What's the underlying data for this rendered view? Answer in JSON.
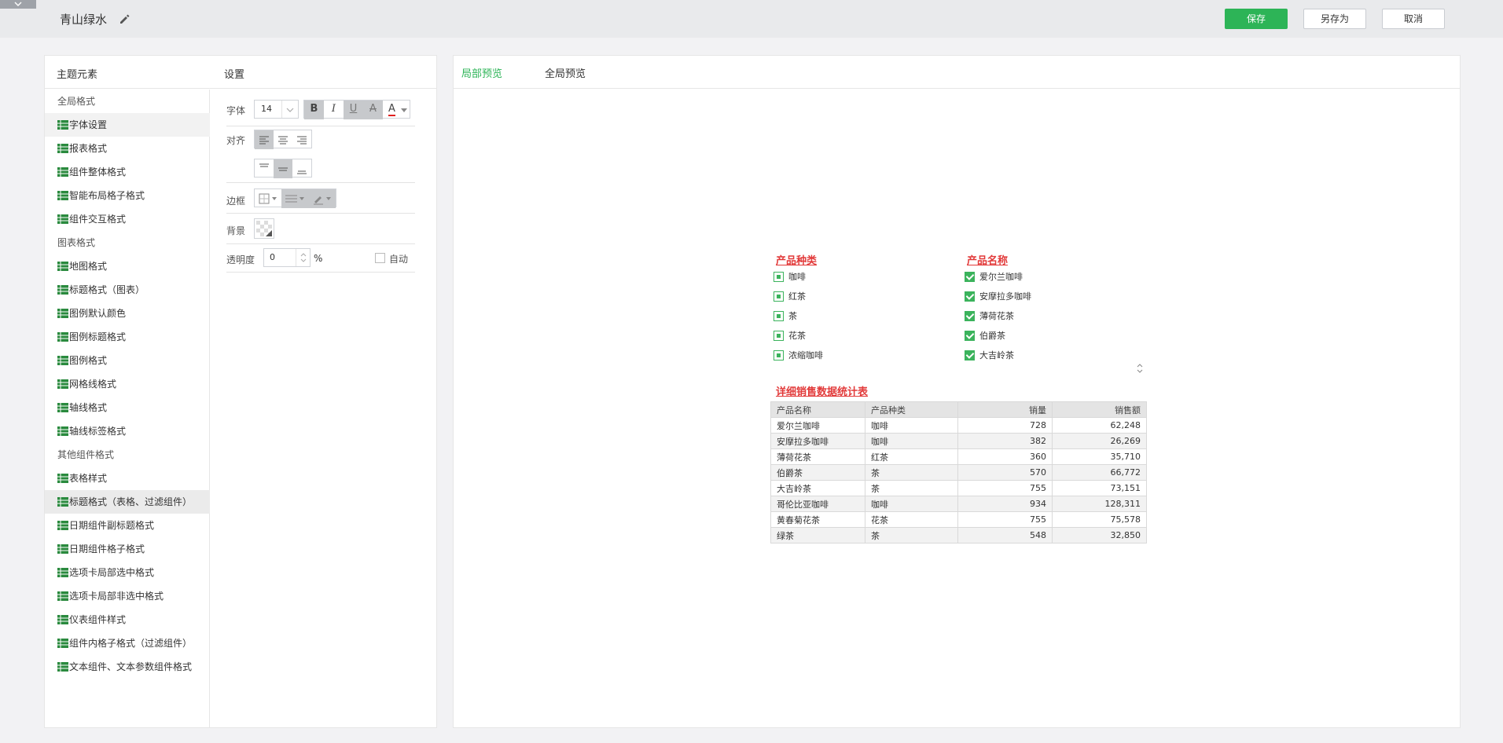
{
  "header": {
    "title": "青山绿水",
    "save_label": "保存",
    "save_as_label": "另存为",
    "cancel_label": "取消",
    "accent_color": "#2db457"
  },
  "left_panel": {
    "elements_header": "主题元素",
    "settings_header": "设置",
    "tree": [
      {
        "label": "全局格式",
        "type": "group"
      },
      {
        "label": "字体设置",
        "type": "leaf",
        "state": "hover"
      },
      {
        "label": "报表格式",
        "type": "leaf"
      },
      {
        "label": "组件整体格式",
        "type": "leaf"
      },
      {
        "label": "智能布局格子格式",
        "type": "leaf"
      },
      {
        "label": "组件交互格式",
        "type": "leaf"
      },
      {
        "label": "图表格式",
        "type": "group"
      },
      {
        "label": "地图格式",
        "type": "leaf"
      },
      {
        "label": "标题格式（图表）",
        "type": "leaf"
      },
      {
        "label": "图例默认颜色",
        "type": "leaf"
      },
      {
        "label": "图例标题格式",
        "type": "leaf"
      },
      {
        "label": "图例格式",
        "type": "leaf"
      },
      {
        "label": "网格线格式",
        "type": "leaf"
      },
      {
        "label": "轴线格式",
        "type": "leaf"
      },
      {
        "label": "轴线标签格式",
        "type": "leaf"
      },
      {
        "label": "其他组件格式",
        "type": "group"
      },
      {
        "label": "表格样式",
        "type": "leaf"
      },
      {
        "label": "标题格式（表格、过滤组件）",
        "type": "leaf",
        "state": "selected"
      },
      {
        "label": "日期组件副标题格式",
        "type": "leaf"
      },
      {
        "label": "日期组件格子格式",
        "type": "leaf"
      },
      {
        "label": "选项卡局部选中格式",
        "type": "leaf"
      },
      {
        "label": "选项卡局部非选中格式",
        "type": "leaf"
      },
      {
        "label": "仪表组件样式",
        "type": "leaf"
      },
      {
        "label": "组件内格子格式（过滤组件）",
        "type": "leaf"
      },
      {
        "label": "文本组件、文本参数组件格式",
        "type": "leaf"
      }
    ],
    "settings": {
      "font_label": "字体",
      "font_size": "14",
      "bold": "B",
      "italic": "I",
      "underline": "U",
      "strike": "A",
      "font_color_glyph": "A",
      "font_color": "#e02020",
      "align_label": "对齐",
      "border_label": "边框",
      "background_label": "背景",
      "opacity_label": "透明度",
      "opacity_value": "0",
      "opacity_unit": "%",
      "auto_label": "自动"
    }
  },
  "preview": {
    "tabs": [
      {
        "label": "局部预览",
        "active": true
      },
      {
        "label": "全局预览",
        "active": false
      }
    ],
    "filter_category": {
      "title": "产品种类",
      "items": [
        "咖啡",
        "红茶",
        "茶",
        "花茶",
        "浓缩咖啡"
      ]
    },
    "filter_name": {
      "title": "产品名称",
      "items": [
        "爱尔兰咖啡",
        "安摩拉多咖啡",
        "薄荷花茶",
        "伯爵茶",
        "大吉岭茶"
      ]
    },
    "table": {
      "title": "详细销售数据统计表",
      "columns": [
        "产品名称",
        "产品种类",
        "销量",
        "销售额"
      ],
      "rows": [
        [
          "爱尔兰咖啡",
          "咖啡",
          "728",
          "62,248"
        ],
        [
          "安摩拉多咖啡",
          "咖啡",
          "382",
          "26,269"
        ],
        [
          "薄荷花茶",
          "红茶",
          "360",
          "35,710"
        ],
        [
          "伯爵茶",
          "茶",
          "570",
          "66,772"
        ],
        [
          "大吉岭茶",
          "茶",
          "755",
          "73,151"
        ],
        [
          "哥伦比亚咖啡",
          "咖啡",
          "934",
          "128,311"
        ],
        [
          "黄春菊花茶",
          "花茶",
          "755",
          "75,578"
        ],
        [
          "绿茶",
          "茶",
          "548",
          "32,850"
        ]
      ]
    },
    "title_color": "#e23a3a",
    "check_color": "#3bb35c"
  }
}
